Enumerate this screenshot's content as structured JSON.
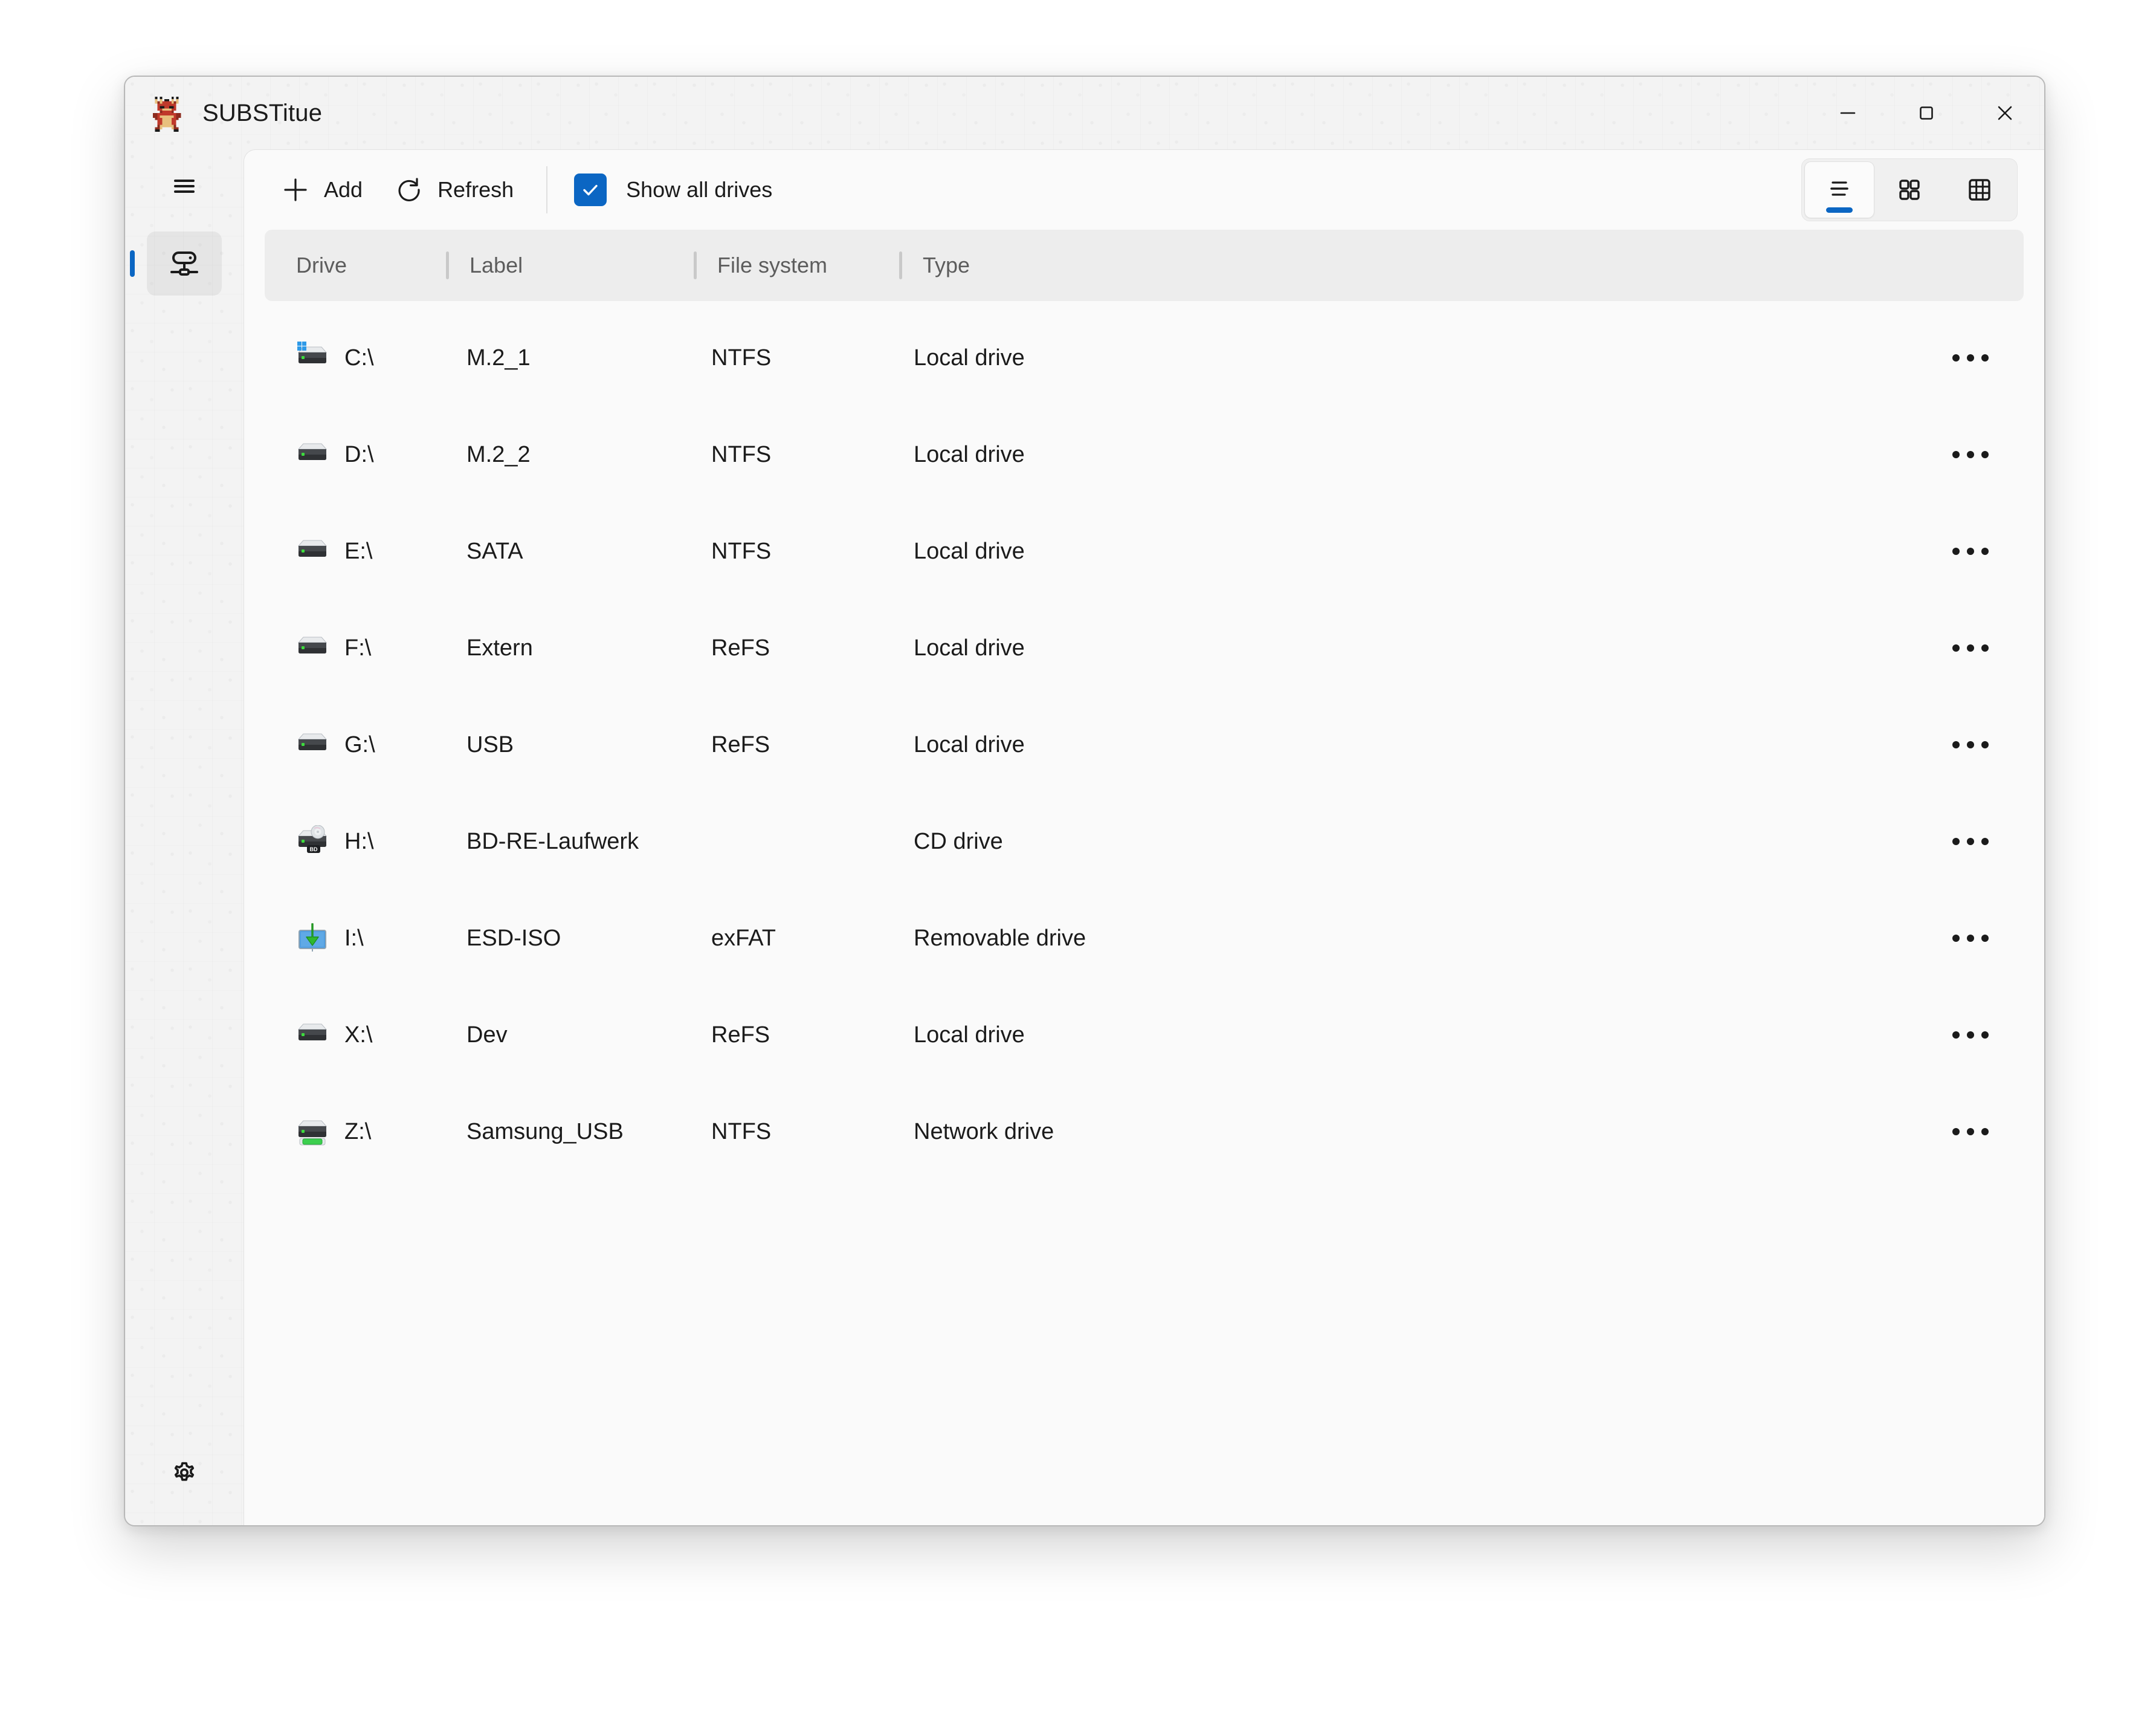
{
  "window": {
    "title": "SUBSTitue",
    "app_icon": "dragon-pixel-icon",
    "controls": {
      "minimize": "minimize-icon",
      "maximize": "maximize-icon",
      "close": "close-icon"
    }
  },
  "nav": {
    "menu_icon": "hamburger-menu-icon",
    "items": [
      {
        "icon": "network-drive-icon",
        "selected": true
      }
    ],
    "settings_icon": "gear-icon"
  },
  "toolbar": {
    "add_label": "Add",
    "add_icon": "plus-icon",
    "refresh_label": "Refresh",
    "refresh_icon": "refresh-icon",
    "show_all_drives_label": "Show all drives",
    "show_all_drives_checked": true,
    "accent_color": "#0b66c3",
    "views": [
      {
        "name": "list-view",
        "icon": "list-icon",
        "selected": true
      },
      {
        "name": "grid-view",
        "icon": "grid-icon",
        "selected": false
      },
      {
        "name": "table-view",
        "icon": "table-icon",
        "selected": false
      }
    ]
  },
  "table": {
    "columns": [
      "Drive",
      "Label",
      "File system",
      "Type"
    ],
    "rows": [
      {
        "drive": "C:\\",
        "label": "M.2_1",
        "fs": "NTFS",
        "type": "Local drive",
        "icon": "windows-drive-icon"
      },
      {
        "drive": "D:\\",
        "label": "M.2_2",
        "fs": "NTFS",
        "type": "Local drive",
        "icon": "hard-drive-icon"
      },
      {
        "drive": "E:\\",
        "label": "SATA",
        "fs": "NTFS",
        "type": "Local drive",
        "icon": "hard-drive-icon"
      },
      {
        "drive": "F:\\",
        "label": "Extern",
        "fs": "ReFS",
        "type": "Local drive",
        "icon": "hard-drive-icon"
      },
      {
        "drive": "G:\\",
        "label": "USB",
        "fs": "ReFS",
        "type": "Local drive",
        "icon": "hard-drive-icon"
      },
      {
        "drive": "H:\\",
        "label": "BD-RE-Laufwerk",
        "fs": "",
        "type": "CD drive",
        "icon": "bluray-drive-icon"
      },
      {
        "drive": "I:\\",
        "label": "ESD-ISO",
        "fs": "exFAT",
        "type": "Removable drive",
        "icon": "removable-drive-icon"
      },
      {
        "drive": "X:\\",
        "label": "Dev",
        "fs": "ReFS",
        "type": "Local drive",
        "icon": "hard-drive-icon"
      },
      {
        "drive": "Z:\\",
        "label": "Samsung_USB",
        "fs": "NTFS",
        "type": "Network drive",
        "icon": "network-mapped-drive-icon"
      }
    ],
    "row_menu_icon": "more-options-icon"
  }
}
